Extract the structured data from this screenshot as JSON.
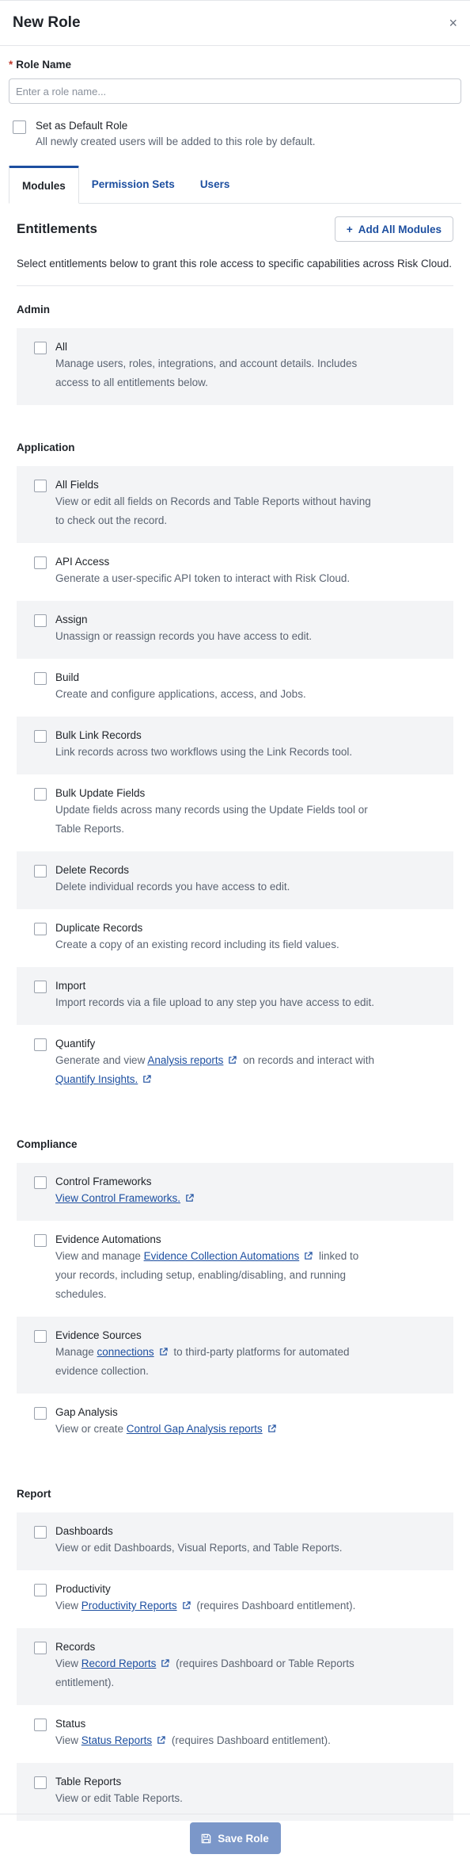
{
  "header": {
    "title": "New Role",
    "close_icon": "×"
  },
  "form": {
    "role_name_label": "Role Name",
    "required_star": "*",
    "role_name_placeholder": "Enter a role name...",
    "default_label": "Set as Default Role",
    "default_help": "All newly created users will be added to this role by default."
  },
  "tabs": [
    {
      "label": "Modules",
      "active": true
    },
    {
      "label": "Permission Sets",
      "active": false
    },
    {
      "label": "Users",
      "active": false
    }
  ],
  "entitlements": {
    "title": "Entitlements",
    "add_all_label": "Add All Modules",
    "add_icon": "+",
    "description": "Select entitlements below to grant this role access to specific capabilities across Risk Cloud."
  },
  "groups": {
    "admin": {
      "title": "Admin",
      "items": [
        {
          "title": "All",
          "desc": "Manage users, roles, integrations, and account details. Includes access to all entitlements below."
        }
      ]
    },
    "application": {
      "title": "Application",
      "items": [
        {
          "title": "All Fields",
          "desc": "View or edit all fields on Records and Table Reports without having to check out the record."
        },
        {
          "title": "API Access",
          "desc": "Generate a user-specific API token to interact with Risk Cloud."
        },
        {
          "title": "Assign",
          "desc": "Unassign or reassign records you have access to edit."
        },
        {
          "title": "Build",
          "desc": "Create and configure applications, access, and Jobs."
        },
        {
          "title": "Bulk Link Records",
          "desc": "Link records across two workflows using the Link Records tool."
        },
        {
          "title": "Bulk Update Fields",
          "desc": "Update fields across many records using the Update Fields tool or Table Reports."
        },
        {
          "title": "Delete Records",
          "desc": "Delete individual records you have access to edit."
        },
        {
          "title": "Duplicate Records",
          "desc": "Create a copy of an existing record including its field values."
        },
        {
          "title": "Import",
          "desc": "Import records via a file upload to any step you have access to edit."
        },
        {
          "title": "Quantify",
          "desc_a": "Generate and view ",
          "link1": "Analysis reports",
          "desc_b": " on records and interact with ",
          "link2": "Quantify Insights."
        }
      ]
    },
    "compliance": {
      "title": "Compliance",
      "items": [
        {
          "title": "Control Frameworks",
          "link": "View Control Frameworks."
        },
        {
          "title": "Evidence Automations",
          "desc_a": "View and manage ",
          "link": "Evidence Collection Automations",
          "desc_b": " linked to your records, including setup, enabling/disabling, and running schedules."
        },
        {
          "title": "Evidence Sources",
          "desc_a": "Manage ",
          "link": "connections",
          "desc_b": " to third-party platforms for automated evidence collection."
        },
        {
          "title": "Gap Analysis",
          "desc_a": "View or create ",
          "link": "Control Gap Analysis reports"
        }
      ]
    },
    "report": {
      "title": "Report",
      "items": [
        {
          "title": "Dashboards",
          "desc": "View or edit Dashboards, Visual Reports, and Table Reports."
        },
        {
          "title": "Productivity",
          "desc_a": "View ",
          "link": "Productivity Reports",
          "desc_b": " (requires Dashboard entitlement)."
        },
        {
          "title": "Records",
          "desc_a": "View ",
          "link": "Record Reports",
          "desc_b": " (requires Dashboard or Table Reports entitlement)."
        },
        {
          "title": "Status",
          "desc_a": "View ",
          "link": "Status Reports",
          "desc_b": " (requires Dashboard entitlement)."
        },
        {
          "title": "Table Reports",
          "desc": "View or edit Table Reports."
        }
      ]
    }
  },
  "footer": {
    "save_label": "Save Role",
    "save_icon": "floppy-disk-icon"
  },
  "colors": {
    "accent": "#1d4fa0",
    "save_button": "#7b97c9",
    "shaded_row": "#f3f4f6"
  }
}
